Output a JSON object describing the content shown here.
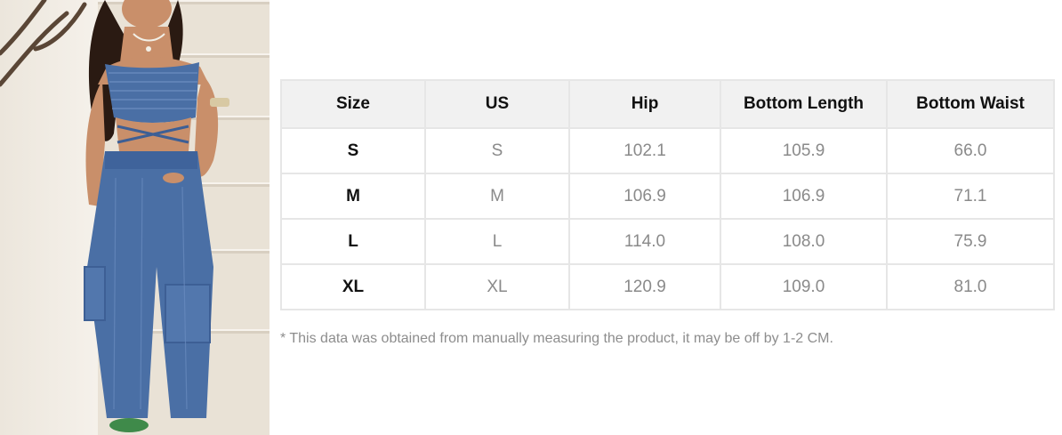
{
  "size_chart": {
    "headers": [
      "Size",
      "US",
      "Hip",
      "Bottom Length",
      "Bottom Waist"
    ],
    "rows": [
      [
        "S",
        "S",
        "102.1",
        "105.9",
        "66.0"
      ],
      [
        "M",
        "M",
        "106.9",
        "106.9",
        "71.1"
      ],
      [
        "L",
        "L",
        "114.0",
        "108.0",
        "75.9"
      ],
      [
        "XL",
        "XL",
        "120.9",
        "109.0",
        "81.0"
      ]
    ]
  },
  "note": "* This data was obtained from manually measuring the product, it may be off by 1-2 CM.",
  "colors": {
    "header_bg": "#f1f1f1",
    "border": "#e6e6e6",
    "muted_text": "#8a8a8a",
    "denim": "#4a6fa5"
  }
}
